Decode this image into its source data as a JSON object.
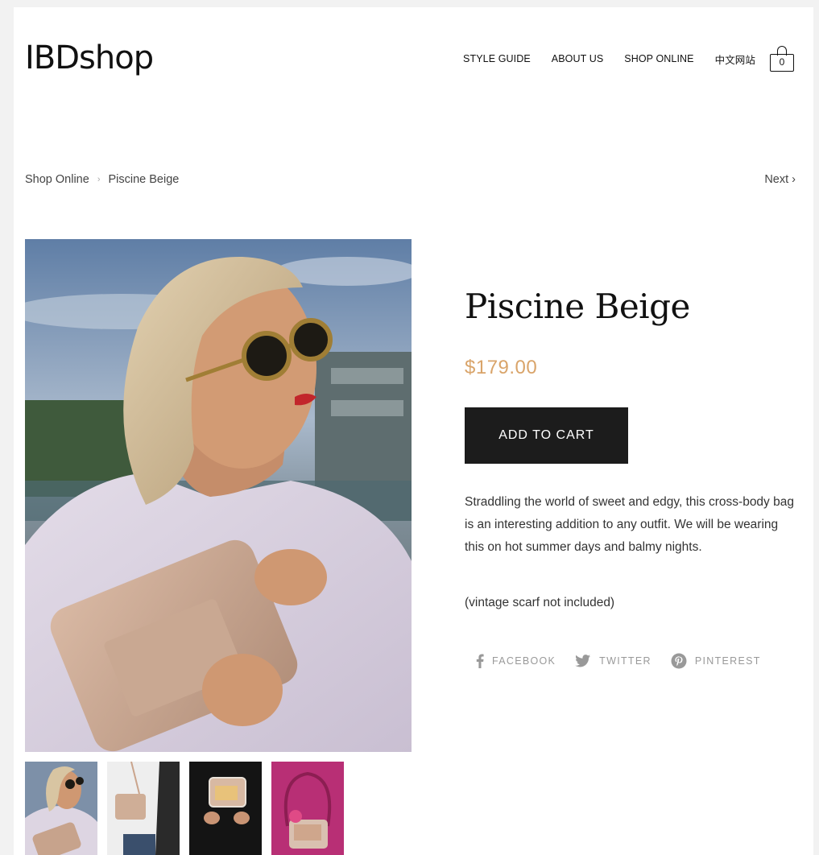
{
  "header": {
    "logo": "IBDshop",
    "nav": [
      {
        "label": "STYLE GUIDE"
      },
      {
        "label": "ABOUT US"
      },
      {
        "label": "SHOP ONLINE"
      },
      {
        "label": "中文网站"
      }
    ],
    "cart_count": "0"
  },
  "breadcrumb": {
    "parent": "Shop Online",
    "separator": "›",
    "current": "Piscine Beige",
    "next": "Next ›"
  },
  "product": {
    "title": "Piscine Beige",
    "price": "$179.00",
    "price_color": "#d9a46a",
    "add_to_cart": "ADD TO CART",
    "description": "Straddling the world of sweet and edgy, this cross-body bag is an interesting addition to any outfit. We will be wearing this on hot summer days and balmy nights.",
    "note": "(vintage scarf not included)"
  },
  "share": {
    "facebook": "FACEBOOK",
    "twitter": "TWITTER",
    "pinterest": "PINTEREST"
  },
  "icons": {
    "cart": "shopping-bag-icon",
    "facebook": "facebook-icon",
    "twitter": "twitter-icon",
    "pinterest": "pinterest-icon"
  }
}
